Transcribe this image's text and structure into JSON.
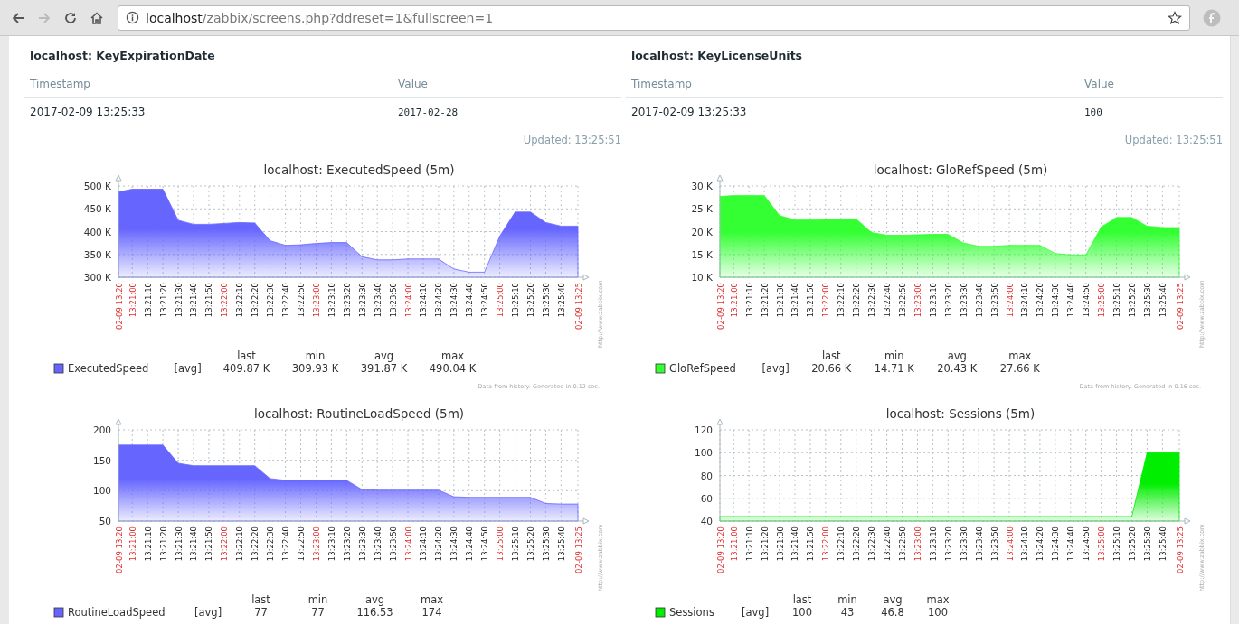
{
  "browser": {
    "url_host": "localhost",
    "url_path": "/zabbix/screens.php?ddreset=1&fullscreen=1"
  },
  "panels": [
    {
      "title": "localhost: KeyExpirationDate",
      "columns": [
        "Timestamp",
        "Value"
      ],
      "rows": [
        [
          "2017-02-09 13:25:33",
          "2017-02-28"
        ]
      ],
      "updated": "Updated: 13:25:51"
    },
    {
      "title": "localhost: KeyLicenseUnits",
      "columns": [
        "Timestamp",
        "Value"
      ],
      "rows": [
        [
          "2017-02-09 13:25:33",
          "100"
        ]
      ],
      "updated": "Updated: 13:25:51"
    }
  ],
  "x_label_highlight": [
    true,
    true,
    false,
    false,
    false,
    false,
    false,
    true,
    false,
    false,
    false,
    false,
    false,
    true,
    false,
    false,
    false,
    false,
    false,
    true,
    false,
    false,
    false,
    false,
    false,
    true,
    false,
    false,
    false,
    false,
    true
  ],
  "graphs": [
    {
      "signature": "http://www.zabbix.com",
      "footer": "Data from history. Generated in 0.12 sec.",
      "legend": {
        "function": "[avg]",
        "headers": [
          "last",
          "min",
          "avg",
          "max"
        ],
        "stats": [
          "409.87 K",
          "309.93 K",
          "391.87 K",
          "490.04 K"
        ]
      },
      "chart_data": {
        "type": "area",
        "title": "localhost: ExecutedSpeed (5m)",
        "grid": true,
        "categories": [
          "02-09 13:20",
          "13:21:00",
          "13:21:10",
          "13:21:20",
          "13:21:30",
          "13:21:40",
          "13:21:50",
          "13:22:00",
          "13:22:10",
          "13:22:20",
          "13:22:30",
          "13:22:40",
          "13:22:50",
          "13:23:00",
          "13:23:10",
          "13:23:20",
          "13:23:30",
          "13:23:40",
          "13:23:50",
          "13:24:00",
          "13:24:10",
          "13:24:20",
          "13:24:30",
          "13:24:40",
          "13:24:50",
          "13:25:00",
          "13:25:10",
          "13:25:20",
          "13:25:30",
          "13:25:40",
          "02-09 13:25"
        ],
        "series": [
          {
            "name": "ExecutedSpeed",
            "color": "#6666ff",
            "values": [
              487,
              493,
              493,
              493,
              425,
              416,
              416,
              418,
              420,
              419,
              380,
              370,
              371,
              374,
              376,
              376,
              345,
              338,
              338,
              340,
              340,
              340,
              318,
              311,
              311,
              390,
              443,
              443,
              420,
              412,
              412
            ]
          }
        ],
        "ylim": [
          300,
          500
        ],
        "yticks": [
          {
            "value": 300,
            "label": "300 K"
          },
          {
            "value": 350,
            "label": "350 K"
          },
          {
            "value": 400,
            "label": "400 K"
          },
          {
            "value": 450,
            "label": "450 K"
          },
          {
            "value": 500,
            "label": "500 K"
          }
        ]
      }
    },
    {
      "signature": "http://www.zabbix.com",
      "footer": "Data from history. Generated in 0.16 sec.",
      "legend": {
        "function": "[avg]",
        "headers": [
          "last",
          "min",
          "avg",
          "max"
        ],
        "stats": [
          "20.66 K",
          "14.71 K",
          "20.43 K",
          "27.66 K"
        ]
      },
      "chart_data": {
        "type": "area",
        "title": "localhost: GloRefSpeed (5m)",
        "grid": true,
        "categories": [
          "02-09 13:20",
          "13:21:00",
          "13:21:10",
          "13:21:20",
          "13:21:30",
          "13:21:40",
          "13:21:50",
          "13:22:00",
          "13:22:10",
          "13:22:20",
          "13:22:30",
          "13:22:40",
          "13:22:50",
          "13:23:00",
          "13:23:10",
          "13:23:20",
          "13:23:30",
          "13:23:40",
          "13:23:50",
          "13:24:00",
          "13:24:10",
          "13:24:20",
          "13:24:30",
          "13:24:40",
          "13:24:50",
          "13:25:00",
          "13:25:10",
          "13:25:20",
          "13:25:30",
          "13:25:40",
          "02-09 13:25"
        ],
        "series": [
          {
            "name": "GloRefSpeed",
            "color": "#33ff33",
            "values": [
              27.7,
              27.9,
              27.9,
              27.9,
              23.5,
              22.6,
              22.6,
              22.7,
              22.8,
              22.8,
              19.8,
              19.2,
              19.2,
              19.3,
              19.4,
              19.4,
              17.5,
              16.8,
              16.8,
              17.0,
              17.0,
              17.0,
              15.2,
              14.9,
              14.9,
              21.0,
              23.1,
              23.1,
              21.2,
              20.9,
              20.9
            ]
          }
        ],
        "ylim": [
          10,
          30
        ],
        "yticks": [
          {
            "value": 10,
            "label": "10 K"
          },
          {
            "value": 15,
            "label": "15 K"
          },
          {
            "value": 20,
            "label": "20 K"
          },
          {
            "value": 25,
            "label": "25 K"
          },
          {
            "value": 30,
            "label": "30 K"
          }
        ]
      }
    },
    {
      "signature": "http://www.zabbix.com",
      "legend": {
        "function": "[avg]",
        "headers": [
          "last",
          "min",
          "avg",
          "max"
        ],
        "stats": [
          "77",
          "77",
          "116.53",
          "174"
        ]
      },
      "chart_data": {
        "type": "area",
        "title": "localhost: RoutineLoadSpeed (5m)",
        "grid": true,
        "categories": [
          "02-09 13:20",
          "13:21:00",
          "13:21:10",
          "13:21:20",
          "13:21:30",
          "13:21:40",
          "13:21:50",
          "13:22:00",
          "13:22:10",
          "13:22:20",
          "13:22:30",
          "13:22:40",
          "13:22:50",
          "13:23:00",
          "13:23:10",
          "13:23:20",
          "13:23:30",
          "13:23:40",
          "13:23:50",
          "13:24:00",
          "13:24:10",
          "13:24:20",
          "13:24:30",
          "13:24:40",
          "13:24:50",
          "13:25:00",
          "13:25:10",
          "13:25:20",
          "13:25:30",
          "13:25:40",
          "02-09 13:25"
        ],
        "series": [
          {
            "name": "RoutineLoadSpeed",
            "color": "#6666ff",
            "values": [
              175,
              175,
              175,
              175,
              145,
              141,
              141,
              141,
              141,
              141,
              120,
              117,
              117,
              117,
              117,
              117,
              102,
              101,
              101,
              101,
              101,
              101,
              90,
              89,
              89,
              89,
              89,
              89,
              79,
              78,
              78
            ]
          }
        ],
        "ylim": [
          50,
          200
        ],
        "yticks": [
          50,
          100,
          150,
          200
        ]
      }
    },
    {
      "signature": "http://www.zabbix.com",
      "legend": {
        "function": "[avg]",
        "headers": [
          "last",
          "min",
          "avg",
          "max"
        ],
        "stats": [
          "100",
          "43",
          "46.8",
          "100"
        ]
      },
      "chart_data": {
        "type": "area",
        "title": "localhost: Sessions (5m)",
        "grid": true,
        "categories": [
          "02-09 13:20",
          "13:21:00",
          "13:21:10",
          "13:21:20",
          "13:21:30",
          "13:21:40",
          "13:21:50",
          "13:22:00",
          "13:22:10",
          "13:22:20",
          "13:22:30",
          "13:22:40",
          "13:22:50",
          "13:23:00",
          "13:23:10",
          "13:23:20",
          "13:23:30",
          "13:23:40",
          "13:23:50",
          "13:24:00",
          "13:24:10",
          "13:24:20",
          "13:24:30",
          "13:24:40",
          "13:24:50",
          "13:25:00",
          "13:25:10",
          "13:25:20",
          "13:25:30",
          "13:25:40",
          "02-09 13:25"
        ],
        "series": [
          {
            "name": "Sessions",
            "color": "#00ee00",
            "values": [
              44,
              44,
              44,
              44,
              44,
              44,
              44,
              44,
              44,
              44,
              44,
              44,
              44,
              44,
              44,
              44,
              44,
              44,
              44,
              44,
              44,
              44,
              44,
              44,
              44,
              44,
              44,
              44,
              100,
              100,
              100
            ]
          }
        ],
        "ylim": [
          40,
          120
        ],
        "yticks": [
          40,
          60,
          80,
          100,
          120
        ]
      }
    }
  ]
}
